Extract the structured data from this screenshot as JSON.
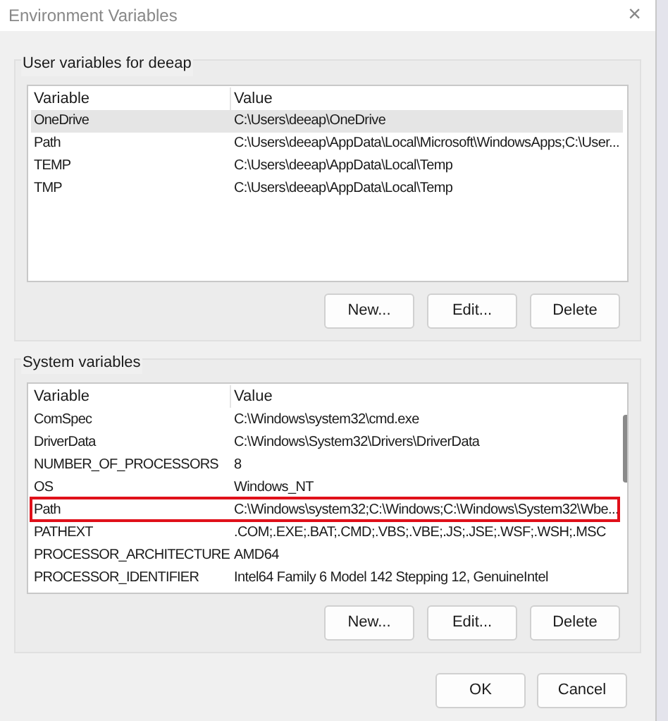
{
  "window": {
    "title": "Environment Variables",
    "close": "×"
  },
  "user_variables": {
    "label": "User variables for deeap",
    "columns": [
      "Variable",
      "Value"
    ],
    "rows": [
      {
        "variable": "OneDrive",
        "value": "C:\\Users\\deeap\\OneDrive",
        "selected": true,
        "highlighted": false
      },
      {
        "variable": "Path",
        "value": "C:\\Users\\deeap\\AppData\\Local\\Microsoft\\WindowsApps;C:\\User...",
        "selected": false,
        "highlighted": false
      },
      {
        "variable": "TEMP",
        "value": "C:\\Users\\deeap\\AppData\\Local\\Temp",
        "selected": false,
        "highlighted": false
      },
      {
        "variable": "TMP",
        "value": "C:\\Users\\deeap\\AppData\\Local\\Temp",
        "selected": false,
        "highlighted": false
      }
    ],
    "buttons": [
      "New...",
      "Edit...",
      "Delete"
    ]
  },
  "system_variables": {
    "label": "System variables",
    "columns": [
      "Variable",
      "Value"
    ],
    "rows": [
      {
        "variable": "ComSpec",
        "value": "C:\\Windows\\system32\\cmd.exe",
        "selected": false,
        "highlighted": false
      },
      {
        "variable": "DriverData",
        "value": "C:\\Windows\\System32\\Drivers\\DriverData",
        "selected": false,
        "highlighted": false
      },
      {
        "variable": "NUMBER_OF_PROCESSORS",
        "value": "8",
        "selected": false,
        "highlighted": false
      },
      {
        "variable": "OS",
        "value": "Windows_NT",
        "selected": false,
        "highlighted": false
      },
      {
        "variable": "Path",
        "value": "C:\\Windows\\system32;C:\\Windows;C:\\Windows\\System32\\Wbe...",
        "selected": false,
        "highlighted": true
      },
      {
        "variable": "PATHEXT",
        "value": ".COM;.EXE;.BAT;.CMD;.VBS;.VBE;.JS;.JSE;.WSF;.WSH;.MSC",
        "selected": false,
        "highlighted": false
      },
      {
        "variable": "PROCESSOR_ARCHITECTURE",
        "value": "AMD64",
        "selected": false,
        "highlighted": false
      },
      {
        "variable": "PROCESSOR_IDENTIFIER",
        "value": "Intel64 Family 6 Model 142 Stepping 12, GenuineIntel",
        "selected": false,
        "highlighted": false
      }
    ],
    "buttons": [
      "New...",
      "Edit...",
      "Delete"
    ]
  },
  "footer_buttons": [
    "OK",
    "Cancel"
  ]
}
